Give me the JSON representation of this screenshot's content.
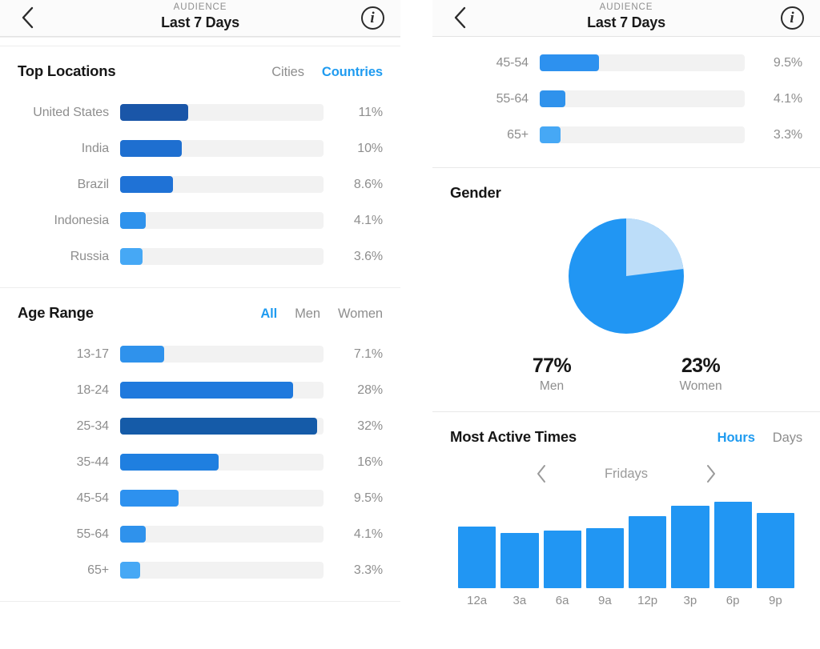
{
  "header": {
    "kicker": "AUDIENCE",
    "title": "Last 7 Days",
    "back_icon": "chevron-left-icon",
    "info_icon": "info-circle-icon",
    "info_glyph": "i"
  },
  "top_locations": {
    "title": "Top Locations",
    "tabs": [
      {
        "label": "Cities",
        "active": false
      },
      {
        "label": "Countries",
        "active": true
      }
    ],
    "rows": [
      {
        "label": "United States",
        "value": "11%",
        "pct": 11.0,
        "color": "#1a56a8"
      },
      {
        "label": "India",
        "value": "10%",
        "pct": 10.0,
        "color": "#1e6fd0"
      },
      {
        "label": "Brazil",
        "value": "8.6%",
        "pct": 8.6,
        "color": "#1f72d6"
      },
      {
        "label": "Indonesia",
        "value": "4.1%",
        "pct": 4.1,
        "color": "#2f92ec"
      },
      {
        "label": "Russia",
        "value": "3.6%",
        "pct": 3.6,
        "color": "#46a8f5"
      }
    ]
  },
  "age_range": {
    "title": "Age Range",
    "tabs": [
      {
        "label": "All",
        "active": true
      },
      {
        "label": "Men",
        "active": false
      },
      {
        "label": "Women",
        "active": false
      }
    ],
    "rows": [
      {
        "label": "13-17",
        "value": "7.1%",
        "pct": 7.1,
        "color": "#2f92ec"
      },
      {
        "label": "18-24",
        "value": "28%",
        "pct": 28.0,
        "color": "#1f79dd"
      },
      {
        "label": "25-34",
        "value": "32%",
        "pct": 32.0,
        "color": "#155ba8"
      },
      {
        "label": "35-44",
        "value": "16%",
        "pct": 16.0,
        "color": "#1f7fe0"
      },
      {
        "label": "45-54",
        "value": "9.5%",
        "pct": 9.5,
        "color": "#2d91ef"
      },
      {
        "label": "55-64",
        "value": "4.1%",
        "pct": 4.1,
        "color": "#2f92ec"
      },
      {
        "label": "65+",
        "value": "3.3%",
        "pct": 3.3,
        "color": "#46a8f5"
      }
    ]
  },
  "age_range_continued": {
    "rows": [
      {
        "label": "45-54",
        "value": "9.5%",
        "pct": 9.5,
        "color": "#2d91ef"
      },
      {
        "label": "55-64",
        "value": "4.1%",
        "pct": 4.1,
        "color": "#2f92ec"
      },
      {
        "label": "65+",
        "value": "3.3%",
        "pct": 3.3,
        "color": "#46a8f5"
      }
    ]
  },
  "gender": {
    "title": "Gender",
    "men_pct": "77%",
    "men_label": "Men",
    "women_pct": "23%",
    "women_label": "Women",
    "men_color": "#2196f3",
    "women_color": "#bcddf9"
  },
  "most_active_times": {
    "title": "Most Active Times",
    "tabs": [
      {
        "label": "Hours",
        "active": true
      },
      {
        "label": "Days",
        "active": false
      }
    ],
    "prev_icon": "chevron-left-icon",
    "next_icon": "chevron-right-icon",
    "day": "Fridays"
  },
  "colors": {
    "accent": "#1f9bf0",
    "bar_blue": "#2196f3",
    "bar_track": "#f2f2f2",
    "text_muted": "#8e8e8e",
    "text_dark": "#161616",
    "divider": "#ededed"
  },
  "chart_data": [
    {
      "type": "bar",
      "title": "Top Locations",
      "orientation": "horizontal",
      "categories": [
        "United States",
        "India",
        "Brazil",
        "Indonesia",
        "Russia"
      ],
      "values": [
        11,
        10,
        8.6,
        4.1,
        3.6
      ],
      "value_labels": [
        "11%",
        "10%",
        "8.6%",
        "4.1%",
        "3.6%"
      ],
      "unit": "%",
      "xlabel": "",
      "ylabel": "",
      "xlim": [
        0,
        33
      ],
      "grid": false,
      "legend": null,
      "selected_tab": "Countries"
    },
    {
      "type": "bar",
      "title": "Age Range",
      "orientation": "horizontal",
      "categories": [
        "13-17",
        "18-24",
        "25-34",
        "35-44",
        "45-54",
        "55-64",
        "65+"
      ],
      "values": [
        7.1,
        28,
        32,
        16,
        9.5,
        4.1,
        3.3
      ],
      "value_labels": [
        "7.1%",
        "28%",
        "32%",
        "16%",
        "9.5%",
        "4.1%",
        "3.3%"
      ],
      "unit": "%",
      "xlabel": "",
      "ylabel": "",
      "xlim": [
        0,
        33
      ],
      "grid": false,
      "legend": null,
      "selected_tab": "All"
    },
    {
      "type": "pie",
      "title": "Gender",
      "labels": [
        "Men",
        "Women"
      ],
      "values": [
        77,
        23
      ],
      "value_labels": [
        "77%",
        "23%"
      ],
      "colors": [
        "#2196f3",
        "#bcddf9"
      ],
      "start_angle_deg": 0,
      "direction": "clockwise",
      "legend": "below"
    },
    {
      "type": "bar",
      "title": "Most Active Times",
      "orientation": "vertical",
      "subtitle": "Fridays",
      "categories": [
        "12a",
        "3a",
        "6a",
        "9a",
        "12p",
        "3p",
        "6p",
        "9p"
      ],
      "values": [
        68,
        61,
        63,
        66,
        79,
        91,
        95,
        83
      ],
      "unit": "relative activity",
      "xlabel": "",
      "ylabel": "",
      "ylim": [
        0,
        100
      ],
      "grid": false,
      "legend": null,
      "selected_tab": "Hours"
    }
  ]
}
